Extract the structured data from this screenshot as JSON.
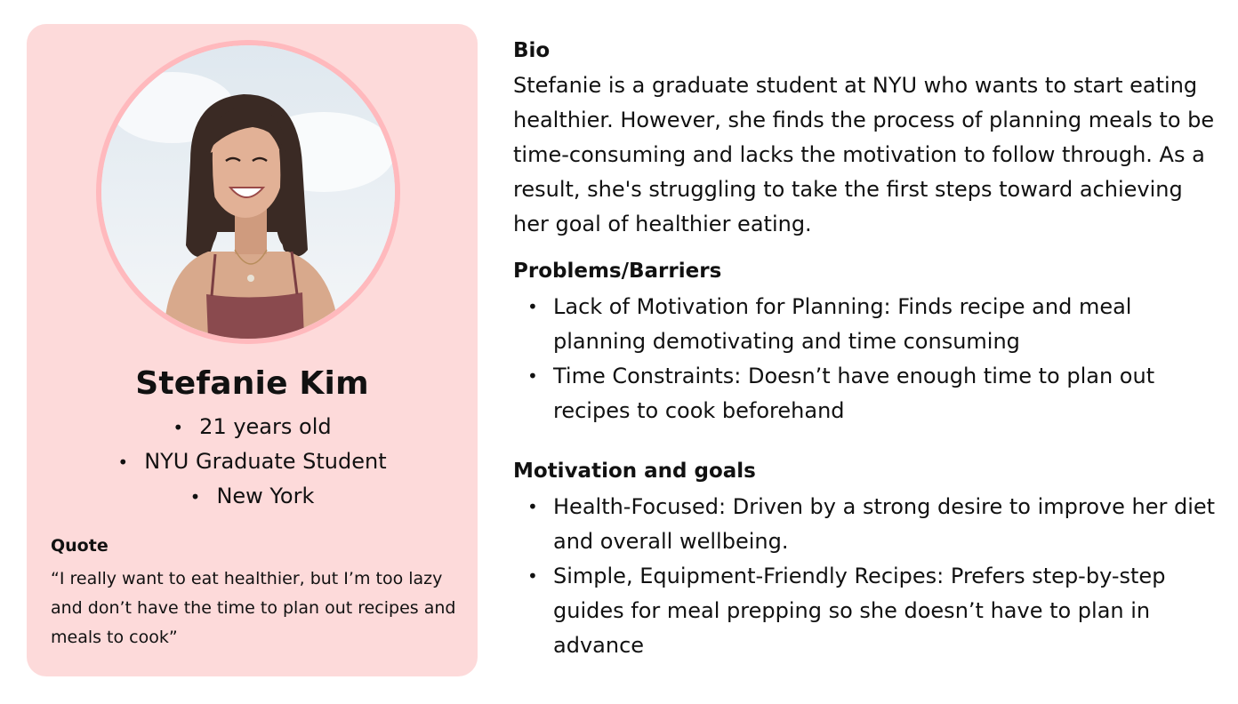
{
  "persona": {
    "name": "Stefanie Kim",
    "facts": [
      "21 years old",
      "NYU Graduate Student",
      "New York"
    ],
    "quote_title": "Quote",
    "quote_text": "“I really want to eat healthier, but I’m too lazy and don’t have the time to plan out recipes and meals to cook”"
  },
  "bio": {
    "title": "Bio",
    "text": "Stefanie is a graduate student at NYU who wants to start eating healthier. However, she finds the process of planning meals to be time-consuming and lacks the motivation to follow through. As a result, she's struggling to take the first steps toward achieving her goal of healthier eating."
  },
  "problems": {
    "title": "Problems/Barriers",
    "items": [
      "Lack of Motivation for Planning: Finds recipe and meal planning demotivating and time consuming",
      "Time Constraints: Doesn’t have enough time to plan out recipes to cook beforehand"
    ]
  },
  "motivation": {
    "title": "Motivation and goals",
    "items": [
      "Health-Focused: Driven by a strong desire to improve her diet and overall wellbeing.",
      "Simple, Equipment-Friendly Recipes: Prefers step-by-step guides for meal prepping so she doesn’t have to plan in advance"
    ]
  },
  "colors": {
    "card_bg": "#fddada",
    "avatar_ring": "#ffb9bd",
    "text": "#111111"
  }
}
